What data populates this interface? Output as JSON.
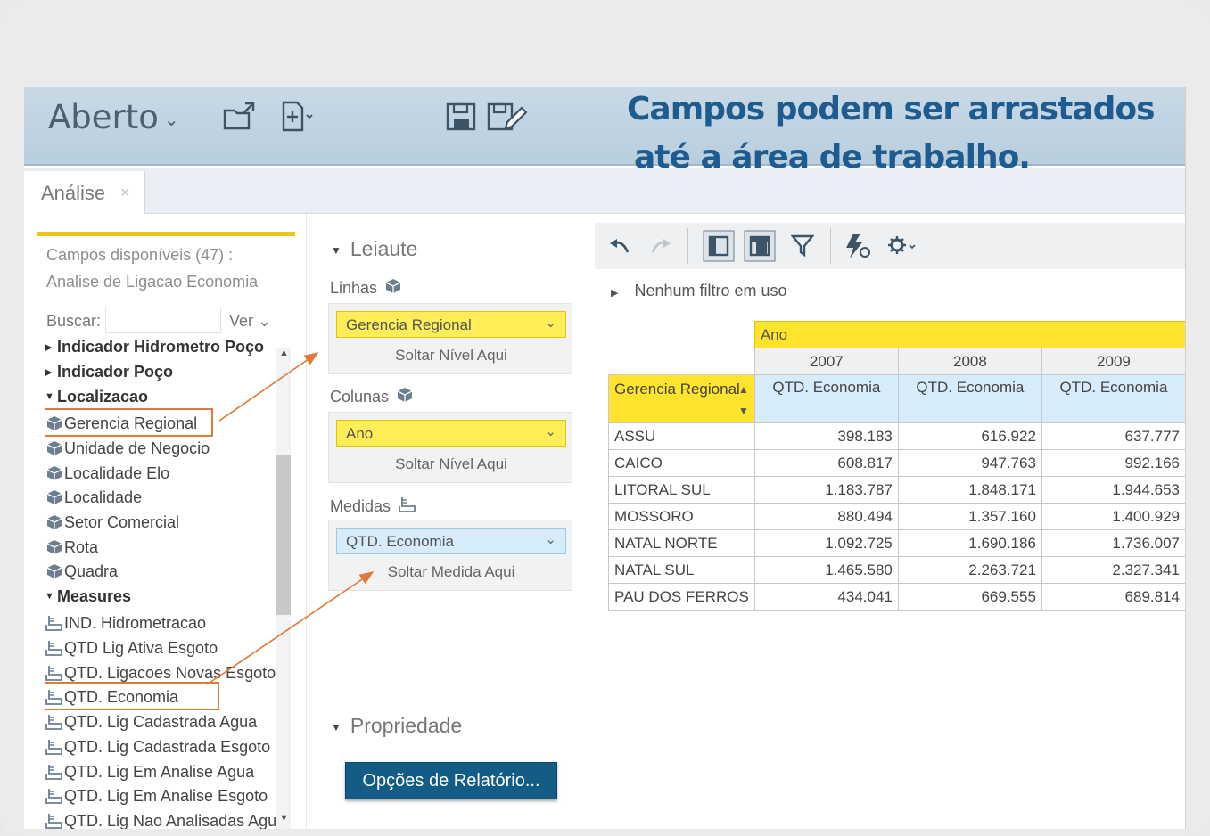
{
  "colors": {
    "accent_yellow": "#ffe32d",
    "measure_blue": "#d6ecfb",
    "headline": "#1e5b8f",
    "highlight_box": "#e07a3a",
    "button": "#125c86"
  },
  "toolbar": {
    "title": "Aberto",
    "icons": [
      "open-folder-icon",
      "new-report-icon",
      "save-icon",
      "save-as-icon"
    ],
    "headline_line1": "Campos podem ser arrastados",
    "headline_line2": "até a área de trabalho."
  },
  "tab": {
    "label": "Análise",
    "close": "×"
  },
  "fields": {
    "count_label": "Campos disponíveis (47) :",
    "model": "Analise de Ligacao Economia",
    "search_label": "Buscar:",
    "search_value": "",
    "ver_label": "Ver"
  },
  "tree": [
    {
      "label": "Indicador Hidrometro Poço",
      "kind": "folder",
      "state": "collapsed"
    },
    {
      "label": "Indicador Poço",
      "kind": "folder",
      "state": "collapsed"
    },
    {
      "label": "Localizacao",
      "kind": "folder",
      "state": "expanded"
    },
    {
      "label": "Gerencia Regional",
      "kind": "level"
    },
    {
      "label": "Unidade de Negocio",
      "kind": "level"
    },
    {
      "label": "Localidade Elo",
      "kind": "level"
    },
    {
      "label": "Localidade",
      "kind": "level"
    },
    {
      "label": "Setor Comercial",
      "kind": "level"
    },
    {
      "label": "Rota",
      "kind": "level"
    },
    {
      "label": "Quadra",
      "kind": "level"
    },
    {
      "label": "Measures",
      "kind": "folder",
      "state": "expanded"
    },
    {
      "label": "IND. Hidrometracao",
      "kind": "measure"
    },
    {
      "label": "QTD Lig Ativa Esgoto",
      "kind": "measure"
    },
    {
      "label": "QTD. Ligacoes Novas Esgoto",
      "kind": "measure"
    },
    {
      "label": "QTD. Economia",
      "kind": "measure"
    },
    {
      "label": "QTD. Lig Cadastrada Agua",
      "kind": "measure"
    },
    {
      "label": "QTD. Lig Cadastrada Esgoto",
      "kind": "measure"
    },
    {
      "label": "QTD. Lig Em Analise Agua",
      "kind": "measure"
    },
    {
      "label": "QTD. Lig Em Analise Esgoto",
      "kind": "measure"
    },
    {
      "label": "QTD. Lig Nao Analisadas Agua",
      "kind": "measure"
    }
  ],
  "layout": {
    "section_title": "Leiaute",
    "rows_label": "Linhas",
    "rows_chip": "Gerencia Regional",
    "rows_drop": "Soltar Nível Aqui",
    "cols_label": "Colunas",
    "cols_chip": "Ano",
    "cols_drop": "Soltar Nível Aqui",
    "measures_label": "Medidas",
    "measures_chip": "QTD. Economia",
    "measures_drop": "Soltar Medida Aqui",
    "props_title": "Propriedade",
    "report_options_button": "Opções de Relatório..."
  },
  "report": {
    "toolbar_icons": [
      "undo-icon",
      "redo-icon",
      "layout-panel-icon",
      "table-view-icon",
      "filter-icon",
      "auto-refresh-icon",
      "settings-icon"
    ],
    "filter_status": "Nenhum filtro em uso",
    "column_dimension": "Ano",
    "row_dimension": "Gerencia Regional",
    "years": [
      "2007",
      "2008",
      "2009"
    ],
    "measure": "QTD. Economia",
    "rows": [
      {
        "name": "ASSU",
        "values": [
          "398.183",
          "616.922",
          "637.777"
        ]
      },
      {
        "name": "CAICO",
        "values": [
          "608.817",
          "947.763",
          "992.166"
        ]
      },
      {
        "name": "LITORAL SUL",
        "values": [
          "1.183.787",
          "1.848.171",
          "1.944.653"
        ]
      },
      {
        "name": "MOSSORO",
        "values": [
          "880.494",
          "1.357.160",
          "1.400.929"
        ]
      },
      {
        "name": "NATAL NORTE",
        "values": [
          "1.092.725",
          "1.690.186",
          "1.736.007"
        ]
      },
      {
        "name": "NATAL SUL",
        "values": [
          "1.465.580",
          "2.263.721",
          "2.327.341"
        ]
      },
      {
        "name": "PAU DOS FERROS",
        "values": [
          "434.041",
          "669.555",
          "689.814"
        ]
      }
    ]
  }
}
